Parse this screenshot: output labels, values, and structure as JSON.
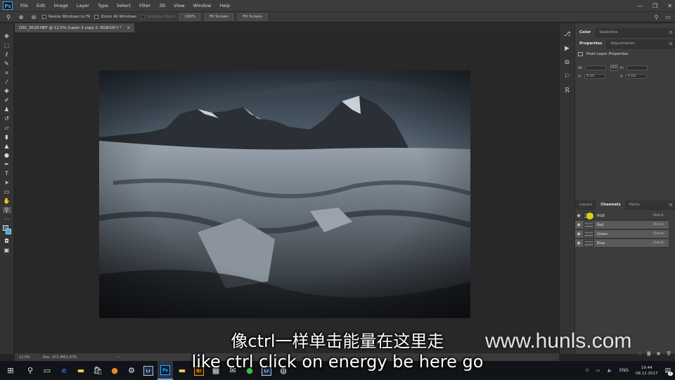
{
  "app": {
    "logo": "Ps",
    "menu": [
      "File",
      "Edit",
      "Image",
      "Layer",
      "Type",
      "Select",
      "Filter",
      "3D",
      "View",
      "Window",
      "Help"
    ]
  },
  "options_bar": {
    "resize_windows": "Resize Windows to Fit",
    "zoom_all": "Zoom All Windows",
    "scrubby_zoom": "Scrubby Zoom",
    "zoom_100": "100%",
    "fit_screen": "Fit Screen",
    "fill_screen": "Fill Screen"
  },
  "document": {
    "tab_title": "DSC_9528.NEF @ 12,5% (Layer 2 copy 2, RGB/16*) *",
    "close": "×"
  },
  "status": {
    "zoom": "12,5%",
    "doc_info": "Doc: 272,3M/1,67G",
    "arrow": "›"
  },
  "panels": {
    "top_tabs": [
      "Color",
      "Swatches"
    ],
    "mid_tabs": [
      "Properties",
      "Adjustments"
    ],
    "props_title": "Pixel Layer Properties",
    "w_label": "W:",
    "h_label": "H:",
    "x_label": "X:",
    "y_label": "Y:",
    "x_value": "0 cm",
    "y_value": "0 cm",
    "link": "GO",
    "layer_tabs": [
      "Layers",
      "Channels",
      "Paths"
    ],
    "channels": [
      {
        "name": "RGB",
        "shortcut": "Ctrl+2"
      },
      {
        "name": "Red",
        "shortcut": "Ctrl+3"
      },
      {
        "name": "Green",
        "shortcut": "Ctrl+4"
      },
      {
        "name": "Blue",
        "shortcut": "Ctrl+5"
      }
    ]
  },
  "taskbar": {
    "apps": [
      "Lr",
      "Ps",
      "Br",
      "Lr"
    ],
    "lang": "ENG",
    "time": "19:44",
    "date": "08.12.2017",
    "notif_count": "2"
  },
  "subtitles": {
    "chinese": "像ctrl一样单击能量在这里走",
    "english": "like ctrl click on energy be here go"
  },
  "watermark": "www.hunls.com",
  "colors": {
    "accent": "#31a8ff",
    "highlight": "#f5e400"
  }
}
